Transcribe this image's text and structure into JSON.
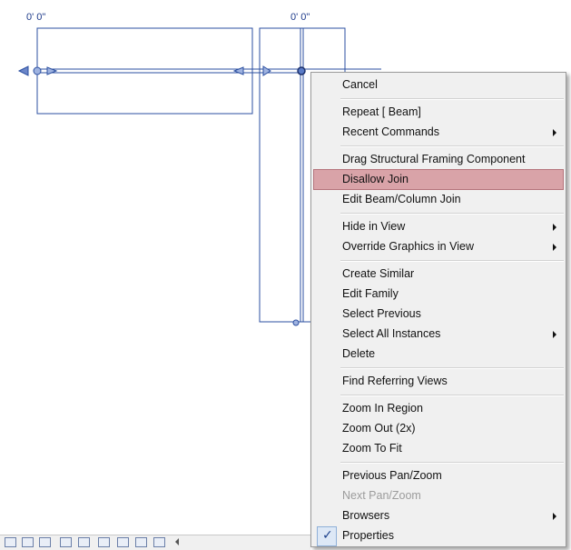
{
  "dimensions": {
    "left_beam": "0'  0\"",
    "right_beam": "0'  0\""
  },
  "context_menu": {
    "items": [
      {
        "label": "Cancel"
      },
      {
        "label": "Repeat [ Beam]"
      },
      {
        "label": "Recent Commands",
        "submenu": true
      },
      {
        "label": "Drag Structural Framing Component"
      },
      {
        "label": "Disallow Join",
        "highlighted": true
      },
      {
        "label": "Edit Beam/Column Join"
      },
      {
        "label": "Hide in View",
        "submenu": true
      },
      {
        "label": "Override Graphics in View",
        "submenu": true
      },
      {
        "label": "Create Similar"
      },
      {
        "label": "Edit Family"
      },
      {
        "label": "Select Previous"
      },
      {
        "label": "Select All Instances",
        "submenu": true
      },
      {
        "label": "Delete"
      },
      {
        "label": "Find Referring Views"
      },
      {
        "label": "Zoom In Region"
      },
      {
        "label": "Zoom Out (2x)"
      },
      {
        "label": "Zoom To Fit"
      },
      {
        "label": "Previous Pan/Zoom"
      },
      {
        "label": "Next Pan/Zoom",
        "disabled": true
      },
      {
        "label": "Browsers",
        "submenu": true
      },
      {
        "label": "Properties",
        "checked": true
      }
    ],
    "check_glyph": "✓"
  },
  "status_bar": {
    "icons": [
      "view-cube-icon",
      "sun-path-icon",
      "shadows-icon",
      "crop-region-icon",
      "show-crop-icon",
      "lock-3d-icon",
      "temporary-hide-icon",
      "reveal-hidden-icon",
      "analytical-model-icon",
      "highlight-displacement-icon"
    ]
  },
  "colors": {
    "model_line": "#2b4fa0",
    "menu_bg": "#f0f0f0",
    "highlight": "#d9a3a8"
  }
}
